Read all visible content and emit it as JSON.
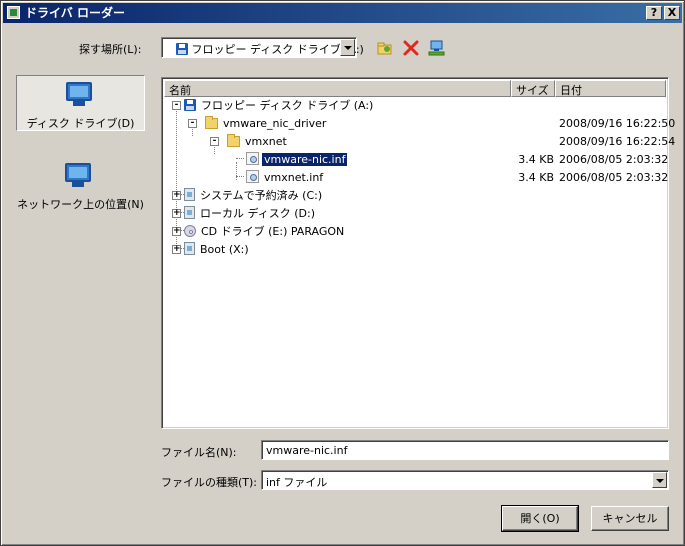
{
  "window": {
    "title": "ドライバ ローダー",
    "help_label": "?",
    "close_label": "X"
  },
  "lookin": {
    "label": "探す場所(L):",
    "value": "フロッピー ディスク ドライブ (A:)"
  },
  "places": [
    {
      "label": "ディスク ドライブ(D)",
      "selected": true
    },
    {
      "label": "ネットワーク上の位置(N)",
      "selected": false
    }
  ],
  "columns": {
    "name": "名前",
    "size": "サイズ",
    "date": "日付"
  },
  "tree": [
    {
      "name": "フロッピー ディスク ドライブ (A:)",
      "size": "",
      "date": "",
      "icon": "floppy-icon"
    },
    {
      "name": "vmware_nic_driver",
      "size": "",
      "date": "2008/09/16 16:22:50",
      "icon": "folder-icon"
    },
    {
      "name": "vmxnet",
      "size": "",
      "date": "2008/09/16 16:22:54",
      "icon": "folder-icon"
    },
    {
      "name": "vmware-nic.inf",
      "size": "3.4 KB",
      "date": "2006/08/05 2:03:32",
      "icon": "inf-file-icon",
      "selected": true
    },
    {
      "name": "vmxnet.inf",
      "size": "3.4 KB",
      "date": "2006/08/05 2:03:32",
      "icon": "inf-file-icon"
    },
    {
      "name": "システムで予約済み (C:)",
      "size": "",
      "date": "",
      "icon": "drive-icon"
    },
    {
      "name": "ローカル ディスク (D:)",
      "size": "",
      "date": "",
      "icon": "drive-icon"
    },
    {
      "name": "CD ドライブ (E:) PARAGON",
      "size": "",
      "date": "",
      "icon": "cd-icon"
    },
    {
      "name": "Boot (X:)",
      "size": "",
      "date": "",
      "icon": "drive-icon"
    }
  ],
  "filename": {
    "label": "ファイル名(N):",
    "value": "vmware-nic.inf"
  },
  "filetype": {
    "label": "ファイルの種類(T):",
    "value": "inf ファイル"
  },
  "buttons": {
    "open": "開く(O)",
    "cancel": "キャンセル"
  }
}
